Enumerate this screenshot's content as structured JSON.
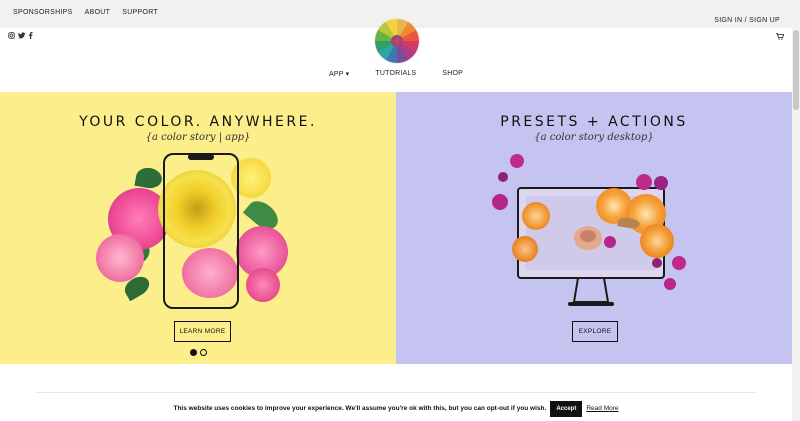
{
  "topbar": {
    "links": [
      "SPONSORSHIPS",
      "ABOUT",
      "SUPPORT"
    ],
    "sign_in": "SIGN IN / SIGN UP"
  },
  "header": {
    "social_icons": [
      "instagram-icon",
      "twitter-icon",
      "facebook-icon"
    ],
    "cart_icon": "cart-icon",
    "nav": [
      "APP ▾",
      "TUTORIALS",
      "SHOP"
    ]
  },
  "hero": {
    "left": {
      "title": "YOUR COLOR. ANYWHERE.",
      "subtitle": "{a color story | app}",
      "button": "LEARN MORE",
      "bg": "#fcee8a"
    },
    "right": {
      "title": "PRESETS + ACTIONS",
      "subtitle": "{a color story desktop}",
      "button": "EXPLORE",
      "bg": "#c5c3f0"
    },
    "slides": 2,
    "active_slide": 1
  },
  "cookie": {
    "message": "This website uses cookies to improve your experience. We'll assume you're ok with this, but you can opt-out if you wish.",
    "accept": "Accept",
    "read_more": "Read More"
  }
}
